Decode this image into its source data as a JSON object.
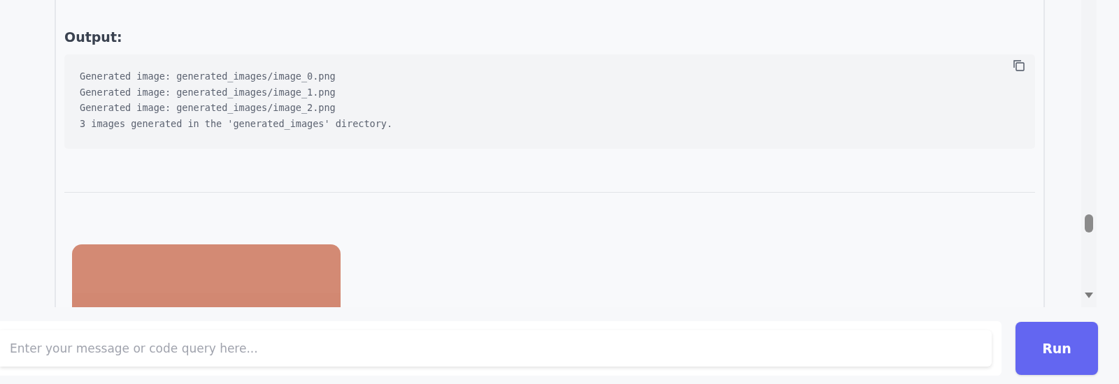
{
  "output": {
    "heading": "Output:",
    "lines": [
      "Generated image: generated_images/image_0.png",
      "Generated image: generated_images/image_1.png",
      "Generated image: generated_images/image_2.png",
      "3 images generated in the 'generated_images' directory."
    ]
  },
  "composer": {
    "placeholder": "Enter your message or code query here...",
    "button": "Run"
  }
}
